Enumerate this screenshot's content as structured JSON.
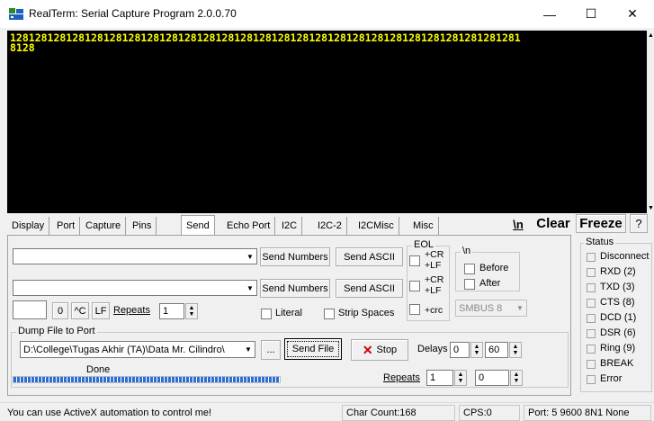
{
  "window": {
    "title": "RealTerm: Serial Capture Program 2.0.0.70",
    "minimize": "—",
    "maximize": "☐",
    "close": "✕"
  },
  "terminal": {
    "lines": [
      "1281281281281281281281281281281281281281281281281281281281281281281281281281281281",
      "8128"
    ],
    "text_color": "#ffff00",
    "background": "#000000"
  },
  "tabs": [
    "Display",
    "Port",
    "Capture",
    "Pins",
    "Send",
    "Echo Port",
    "I2C",
    "I2C-2",
    "I2CMisc",
    "Misc"
  ],
  "active_tab": "Send",
  "toolbar": {
    "newline_label": "\\n",
    "clear_label": "Clear",
    "freeze_label": "Freeze",
    "help_label": "?"
  },
  "send": {
    "send_numbers_label": "Send Numbers",
    "send_ascii_label": "Send ASCII",
    "input1_value": "",
    "input2_value": "",
    "small_input_value": "",
    "zero_label": "0",
    "ctrl_c_label": "^C",
    "lf_label": "LF",
    "repeats_label": "Repeats",
    "repeats_value": "1",
    "literal_label": "Literal",
    "strip_spaces_label": "Strip Spaces"
  },
  "eol": {
    "title": "EOL",
    "cr1": "+CR",
    "lf1": "+LF",
    "cr2": "+CR",
    "lf2": "+LF",
    "crc": "+crc"
  },
  "newline_group": {
    "title": "\\n",
    "before": "Before",
    "after": "After"
  },
  "smbus": {
    "value": "SMBUS 8"
  },
  "dump": {
    "title": "Dump File to Port",
    "path": "D:\\College\\Tugas Akhir (TA)\\Data Mr. Cilindro\\",
    "browse_label": "...",
    "send_file_label": "Send File",
    "stop_label": "Stop",
    "delays_label": "Delays",
    "delay1": "0",
    "delay2": "60",
    "repeats_label": "Repeats",
    "repeats1": "1",
    "repeats2": "0",
    "progress_label": "Done",
    "progress_fraction": 1.0
  },
  "status": {
    "title": "Status",
    "items": [
      "Disconnect",
      "RXD (2)",
      "TXD (3)",
      "CTS (8)",
      "DCD (1)",
      "DSR (6)",
      "Ring (9)",
      "BREAK",
      "Error"
    ]
  },
  "statusbar": {
    "message": "You can use ActiveX automation to control me!",
    "char_count": "Char Count:168",
    "cps": "CPS:0",
    "port": "Port: 5 9600 8N1 None"
  }
}
